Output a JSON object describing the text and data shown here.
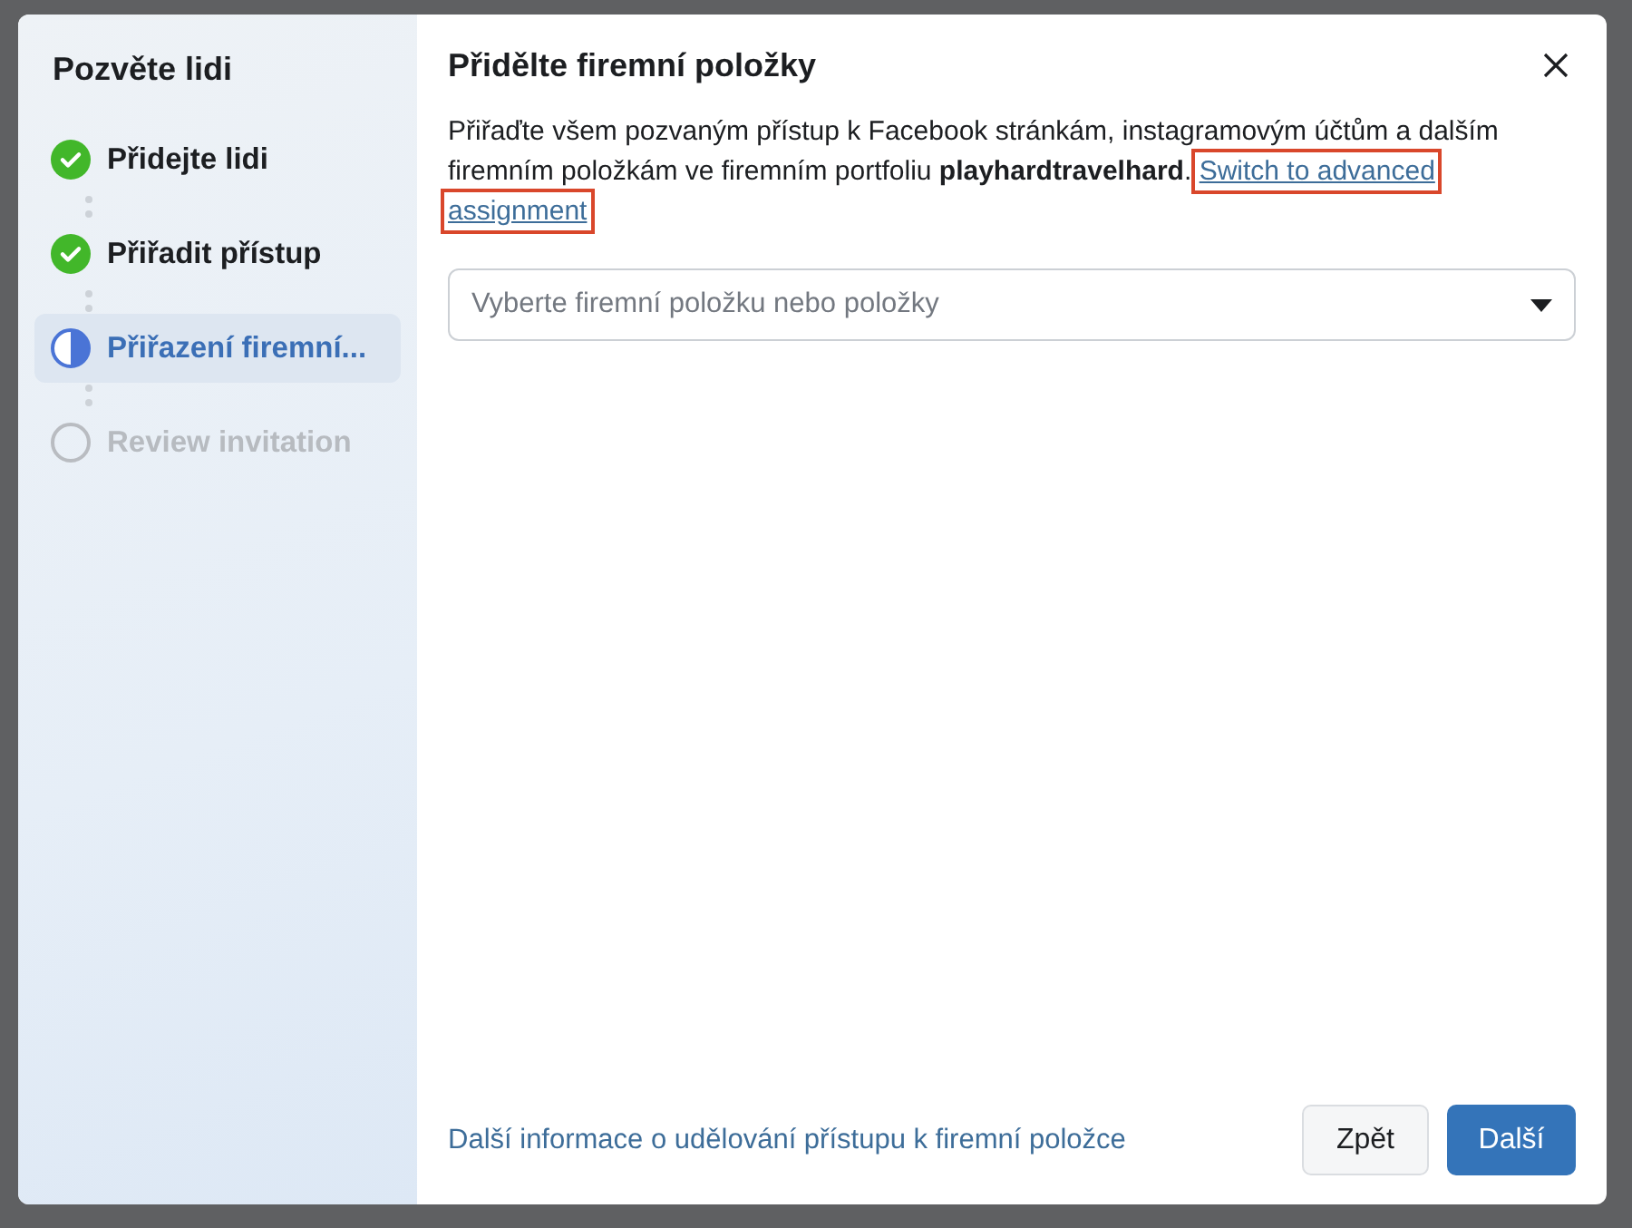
{
  "sidebar": {
    "title": "Pozvěte lidi",
    "steps": [
      {
        "label": "Přidejte lidi",
        "kind": "done",
        "selected": false
      },
      {
        "label": "Přiřadit přístup",
        "kind": "done",
        "selected": false
      },
      {
        "label": "Přiřazení firemní...",
        "kind": "current",
        "selected": true
      },
      {
        "label": "Review invitation",
        "kind": "pending",
        "selected": false
      }
    ]
  },
  "dialog": {
    "title": "Přidělte firemní položky",
    "description": "Přiřaďte všem pozvaným přístup k Facebook stránkám, instagramovým účtům a dalším firemním položkám ve firemním portfoliu **playhardtravelhard**.",
    "link_lines": [
      {
        "text": "Switch to advanced",
        "highlighted": true
      },
      {
        "text": "assignment",
        "highlighted": true
      }
    ],
    "select": {
      "placeholder": "Vyberte firemní položku nebo položky"
    },
    "footer_link": "Další informace o udělování přístupu k firemní položce",
    "buttons": [
      {
        "label": "Zpět",
        "kind": "secondary"
      },
      {
        "label": "Další",
        "kind": "primary"
      }
    ]
  }
}
